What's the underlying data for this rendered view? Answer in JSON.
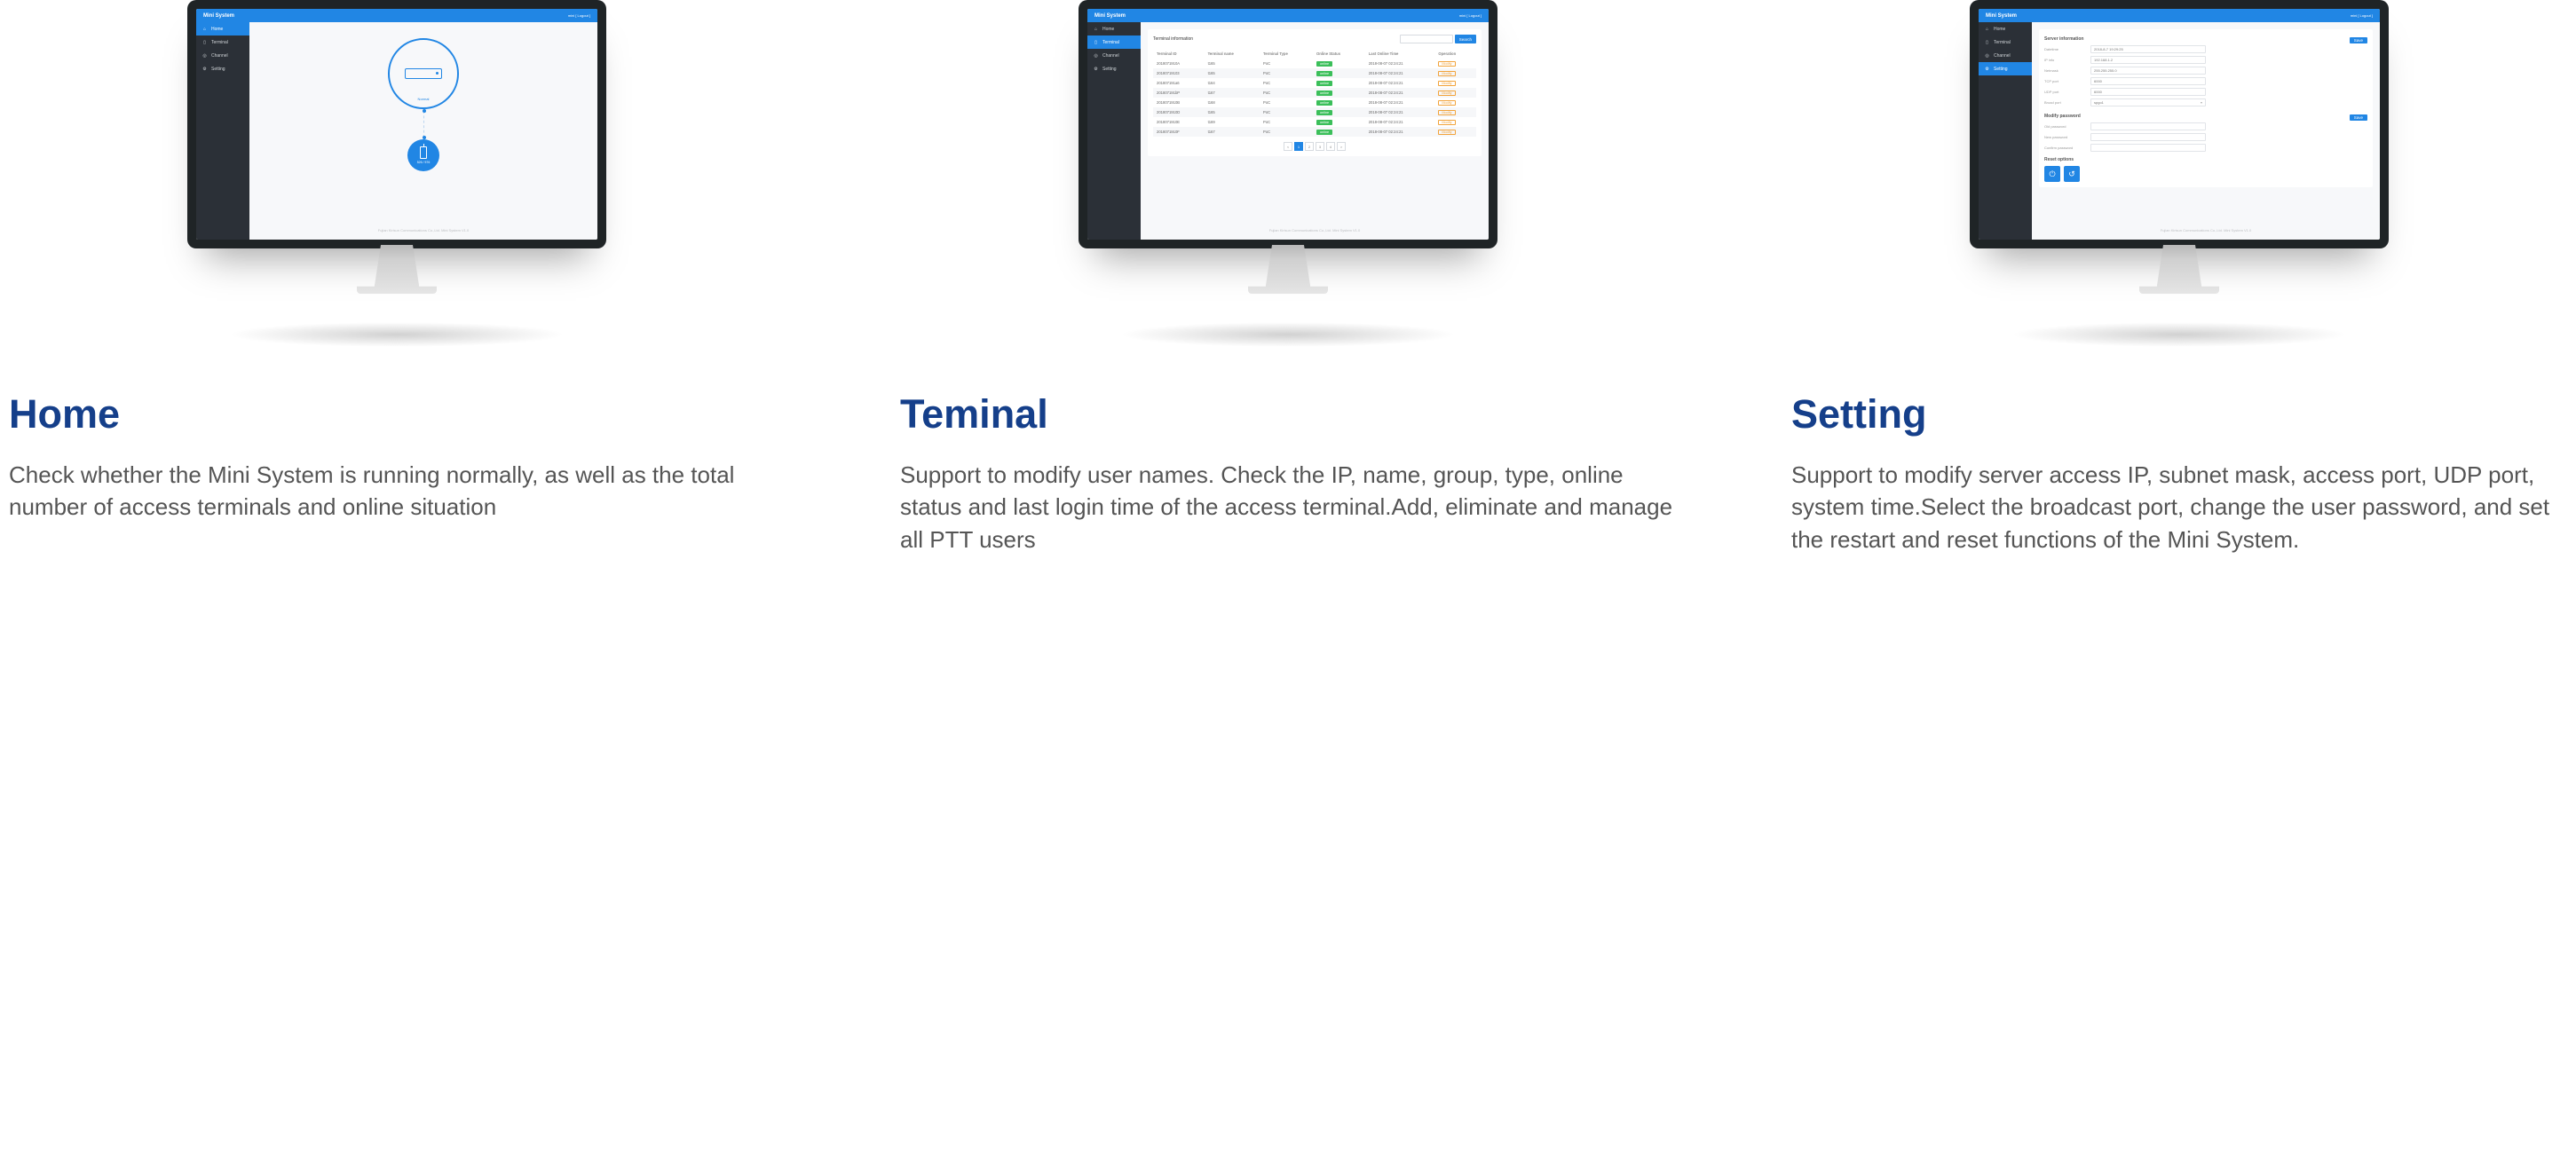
{
  "common": {
    "app_title": "Mini System",
    "user_area": "mini  [ Logout ]",
    "sidebar": [
      {
        "label": "Home"
      },
      {
        "label": "Terminal"
      },
      {
        "label": "Channel"
      },
      {
        "label": "Setting"
      }
    ],
    "footer": "Fujian Kirisun Communications Co.,Ltd. Mini System V1.0"
  },
  "home_screen": {
    "server_label": "Normal",
    "terminal_label": "526 / 576"
  },
  "terminal_screen": {
    "panel_title": "Terminal information",
    "search_btn": "Search",
    "columns": [
      "Terminal ID",
      "Terminal name",
      "Terminal Type",
      "Online Status",
      "Last Online Time",
      "Operation"
    ],
    "status_text": "online",
    "op_text": "Modify",
    "rows": [
      {
        "id": "2018071910A",
        "name": "t165",
        "type": "PoC",
        "time": "2018-08-07 02:24:21"
      },
      {
        "id": "20180719103",
        "name": "t165",
        "type": "PoC",
        "time": "2018-08-07 02:24:21"
      },
      {
        "id": "201807191a6",
        "name": "t164",
        "type": "PoC",
        "time": "2018-08-07 02:24:21"
      },
      {
        "id": "201807191bP",
        "name": "t167",
        "type": "PoC",
        "time": "2018-08-07 02:24:21"
      },
      {
        "id": "2018071910B",
        "name": "t168",
        "type": "PoC",
        "time": "2018-08-07 02:24:21"
      },
      {
        "id": "2018071910D",
        "name": "t165",
        "type": "PoC",
        "time": "2018-08-07 02:24:21"
      },
      {
        "id": "2018071910E",
        "name": "t169",
        "type": "PoC",
        "time": "2018-08-07 02:24:21"
      },
      {
        "id": "2018071910F",
        "name": "t167",
        "type": "PoC",
        "time": "2018-08-07 02:24:21"
      }
    ],
    "pager": {
      "prev": "<",
      "pages": [
        "1",
        "2",
        "3",
        "4"
      ],
      "next": ">"
    }
  },
  "setting_screen": {
    "server_section_title": "Server information",
    "save_btn": "Save",
    "fields": {
      "datetime_label": "Datetime",
      "datetime_val": "2018-8-7 19:29:25",
      "ip_label": "IP info",
      "ip_val": "192.168.1.2",
      "netmask_label": "Netmask",
      "netmask_val": "255.255.255.0",
      "tcp_label": "TCP port",
      "tcp_val": "6000",
      "udp_label": "UDP port",
      "udp_val": "6000",
      "bport_label": "Broad port",
      "bport_val": "spgo1"
    },
    "password_section_title": "Modify password",
    "pw_fields": {
      "old_label": "Old password",
      "new_label": "New password",
      "confirm_label": "Confirm password"
    },
    "reset_section_title": "Reset options"
  },
  "features": [
    {
      "title": "Home",
      "desc": "Check whether the Mini System is running normally, as well as the total number of access terminals and online situation"
    },
    {
      "title": "Teminal",
      "desc": "Support to modify user names. Check the IP, name, group, type, online status and last login time of the access terminal.Add, eliminate and manage all PTT users"
    },
    {
      "title": "Setting",
      "desc": "Support to modify server access IP, subnet mask, access port, UDP port, system time.Select the broadcast port, change the user password, and set the restart and reset functions of the Mini System."
    }
  ]
}
